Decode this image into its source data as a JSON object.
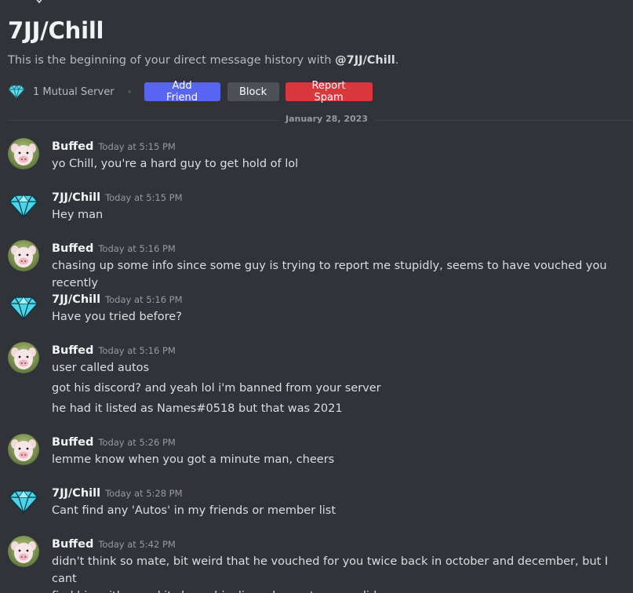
{
  "header": {
    "title": "7JJ/Chill",
    "intro_prefix": "This is the beginning of your direct message history with ",
    "intro_mention": "@7JJ/Chill",
    "intro_suffix": "."
  },
  "actions": {
    "mutual_servers": "1 Mutual Server",
    "add_friend": "Add Friend",
    "block": "Block",
    "report_spam": "Report Spam"
  },
  "date_divider": "January 28, 2023",
  "messages": [
    {
      "author": "Buffed",
      "time": "Today at 5:15 PM",
      "avatar": "pig-avatar",
      "lines": [
        "yo Chill, you're a hard guy to get hold of lol"
      ]
    },
    {
      "author": "7JJ/Chill",
      "time": "Today at 5:15 PM",
      "avatar": "diamond-avatar",
      "lines": [
        "Hey man"
      ]
    },
    {
      "author": "Buffed",
      "time": "Today at 5:16 PM",
      "avatar": "pig-avatar",
      "lines": [
        "chasing up some info since some guy is trying to report me stupidly, seems to have vouched you recently"
      ]
    },
    {
      "author": "7JJ/Chill",
      "time": "Today at 5:16 PM",
      "avatar": "diamond-avatar",
      "lines": [
        "Have you tried before?"
      ]
    },
    {
      "author": "Buffed",
      "time": "Today at 5:16 PM",
      "avatar": "pig-avatar",
      "lines": [
        "user called autos",
        "got his discord? and yeah lol i'm banned from your server",
        "he had it listed as Names#0518 but that was 2021"
      ]
    },
    {
      "author": "Buffed",
      "time": "Today at 5:26 PM",
      "avatar": "pig-avatar",
      "lines": [
        "lemme know when you got a minute man, cheers"
      ]
    },
    {
      "author": "7JJ/Chill",
      "time": "Today at 5:28 PM",
      "avatar": "diamond-avatar",
      "lines": [
        "Cant find any 'Autos' in my friends or member list"
      ]
    },
    {
      "author": "Buffed",
      "time": "Today at 5:42 PM",
      "avatar": "pig-avatar",
      "lines": [
        "didn't think so mate, bit weird that he vouched for you twice back in october and december, but I cant",
        "find him either and it shows his discord as not even valid"
      ]
    }
  ]
}
